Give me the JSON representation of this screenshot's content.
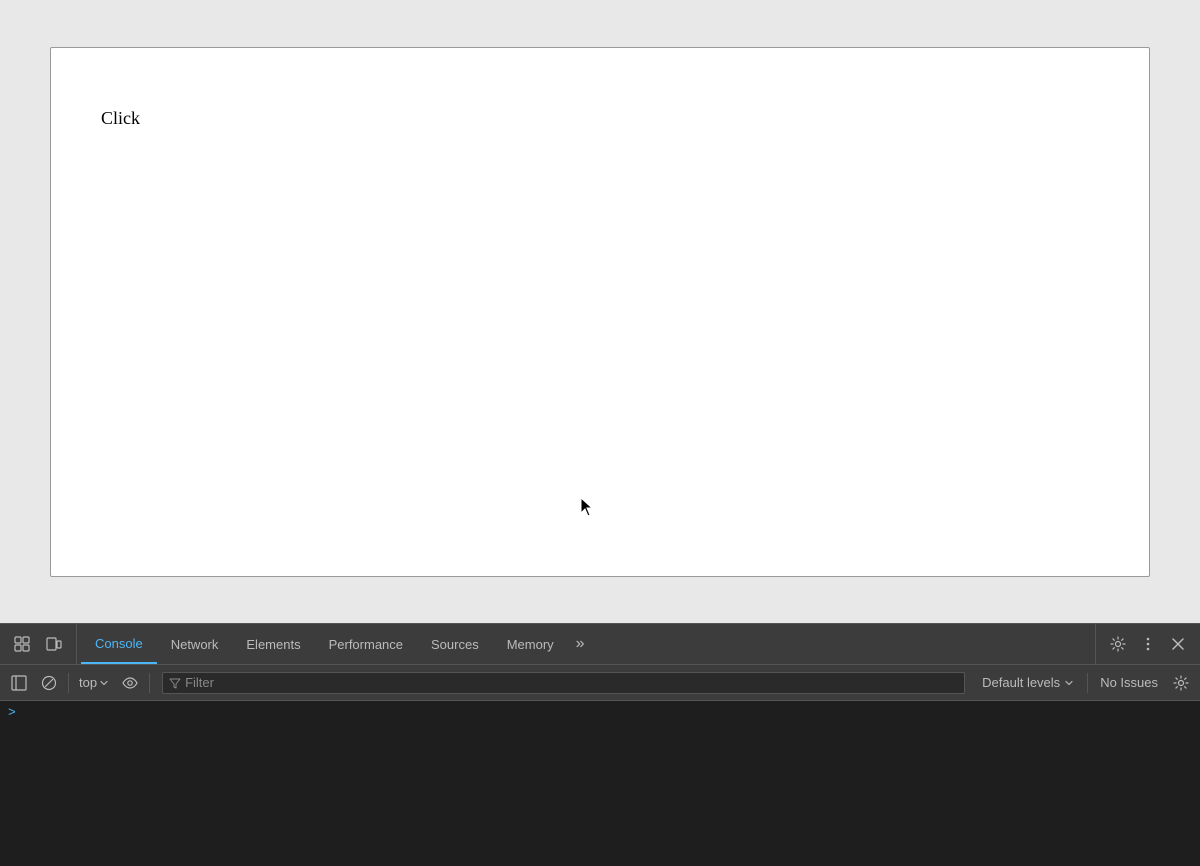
{
  "browser": {
    "page": {
      "click_text": "Click"
    }
  },
  "devtools": {
    "tabs": [
      {
        "id": "console",
        "label": "Console",
        "active": true
      },
      {
        "id": "network",
        "label": "Network",
        "active": false
      },
      {
        "id": "elements",
        "label": "Elements",
        "active": false
      },
      {
        "id": "performance",
        "label": "Performance",
        "active": false
      },
      {
        "id": "sources",
        "label": "Sources",
        "active": false
      },
      {
        "id": "memory",
        "label": "Memory",
        "active": false
      }
    ],
    "more_tabs_label": "»",
    "console_toolbar": {
      "top_label": "top",
      "filter_placeholder": "Filter",
      "default_levels_label": "Default levels",
      "no_issues_label": "No Issues"
    },
    "console_prompt": ">"
  }
}
